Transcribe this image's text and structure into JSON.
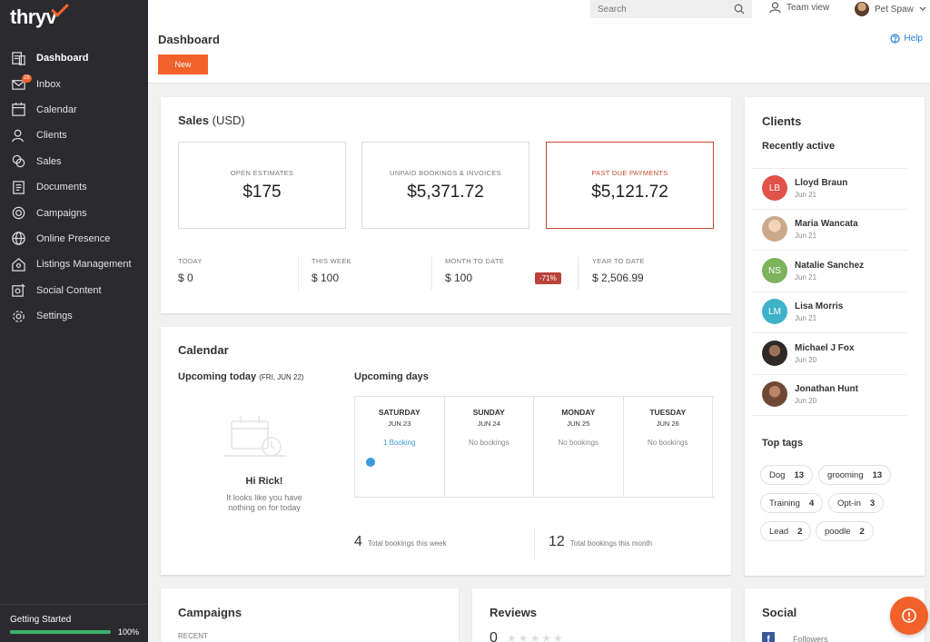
{
  "app": {
    "logo": "thryv"
  },
  "sidebar": {
    "items": [
      {
        "label": "Dashboard",
        "icon": "dashboard-icon"
      },
      {
        "label": "Inbox",
        "icon": "inbox-icon",
        "badge": "28"
      },
      {
        "label": "Calendar",
        "icon": "calendar-icon"
      },
      {
        "label": "Clients",
        "icon": "clients-icon"
      },
      {
        "label": "Sales",
        "icon": "sales-icon"
      },
      {
        "label": "Documents",
        "icon": "documents-icon"
      },
      {
        "label": "Campaigns",
        "icon": "campaigns-icon"
      },
      {
        "label": "Online Presence",
        "icon": "globe-icon"
      },
      {
        "label": "Listings Management",
        "icon": "listings-icon"
      },
      {
        "label": "Social Content",
        "icon": "social-icon"
      },
      {
        "label": "Settings",
        "icon": "gear-icon"
      }
    ],
    "getting_started": {
      "label": "Getting Started",
      "percent": "100%",
      "progress": 1.0
    }
  },
  "topbar": {
    "search_placeholder": "Search",
    "team_view": "Team view",
    "user_name": "Pet Spaw"
  },
  "header": {
    "title": "Dashboard",
    "new_label": "New",
    "help_label": "Help"
  },
  "sales": {
    "title": "Sales",
    "title_unit": "(USD)",
    "boxes": [
      {
        "label": "OPEN ESTIMATES",
        "value": "$175"
      },
      {
        "label": "UNPAID BOOKINGS & INVOICES",
        "value": "$5,371.72"
      },
      {
        "label": "PAST DUE PAYMENTS",
        "value": "$5,121.72"
      }
    ],
    "periods": [
      {
        "label": "TODAY",
        "value": "$ 0"
      },
      {
        "label": "THIS WEEK",
        "value": "$ 100"
      },
      {
        "label": "MONTH TO DATE",
        "value": "$ 100"
      },
      {
        "label": "YEAR TO DATE",
        "value": "$ 2,506.99"
      }
    ],
    "change_pill": "-71%"
  },
  "calendar": {
    "title": "Calendar",
    "upcoming_today": "Upcoming today",
    "today_date": "(FRI, JUN 22)",
    "upcoming_days": "Upcoming days",
    "greeting": "Hi Rick!",
    "empty_line1": "It looks like you have",
    "empty_line2": "nothing on for today",
    "days": [
      {
        "name": "SATURDAY",
        "date": "JUN 23",
        "bookings": "1 Booking"
      },
      {
        "name": "SUNDAY",
        "date": "JUN 24",
        "bookings": "No bookings"
      },
      {
        "name": "MONDAY",
        "date": "JUN 25",
        "bookings": "No bookings"
      },
      {
        "name": "TUESDAY",
        "date": "JUN 26",
        "bookings": "No bookings"
      }
    ],
    "week_total": "4",
    "week_label": "Total bookings this week",
    "month_total": "12",
    "month_label": "Total bookings this month"
  },
  "clients": {
    "title": "Clients",
    "recent_title": "Recently active",
    "list": [
      {
        "name": "Lloyd Braun",
        "date": "Jun 21",
        "initials": "LB",
        "color": "#e0524a"
      },
      {
        "name": "Maria Wancata",
        "date": "Jun 21",
        "initials": "",
        "color": "#c9a98a"
      },
      {
        "name": "Natalie Sanchez",
        "date": "Jun 21",
        "initials": "NS",
        "color": "#7cb35c"
      },
      {
        "name": "Lisa Morris",
        "date": "Jun 21",
        "initials": "LM",
        "color": "#3fb1c9"
      },
      {
        "name": "Michael J Fox",
        "date": "Jun 20",
        "initials": "",
        "color": "#2f2a28"
      },
      {
        "name": "Jonathan Hunt",
        "date": "Jun 20",
        "initials": "",
        "color": "#6e4a36"
      }
    ],
    "tags_title": "Top tags",
    "tags": [
      {
        "label": "Dog",
        "count": "13"
      },
      {
        "label": "grooming",
        "count": "13"
      },
      {
        "label": "Training",
        "count": "4"
      },
      {
        "label": "Opt-in",
        "count": "3"
      },
      {
        "label": "Lead",
        "count": "2"
      },
      {
        "label": "poodle",
        "count": "2"
      }
    ]
  },
  "campaigns": {
    "title": "Campaigns",
    "recent": "RECENT"
  },
  "reviews": {
    "title": "Reviews",
    "score": "0",
    "stars": "★★★★★"
  },
  "social": {
    "title": "Social",
    "followers": "Followers"
  },
  "colors": {
    "accent": "#f2612a",
    "sidebar": "#2b2b2f",
    "alert": "#c14b2e",
    "link": "#3a9bd9"
  }
}
